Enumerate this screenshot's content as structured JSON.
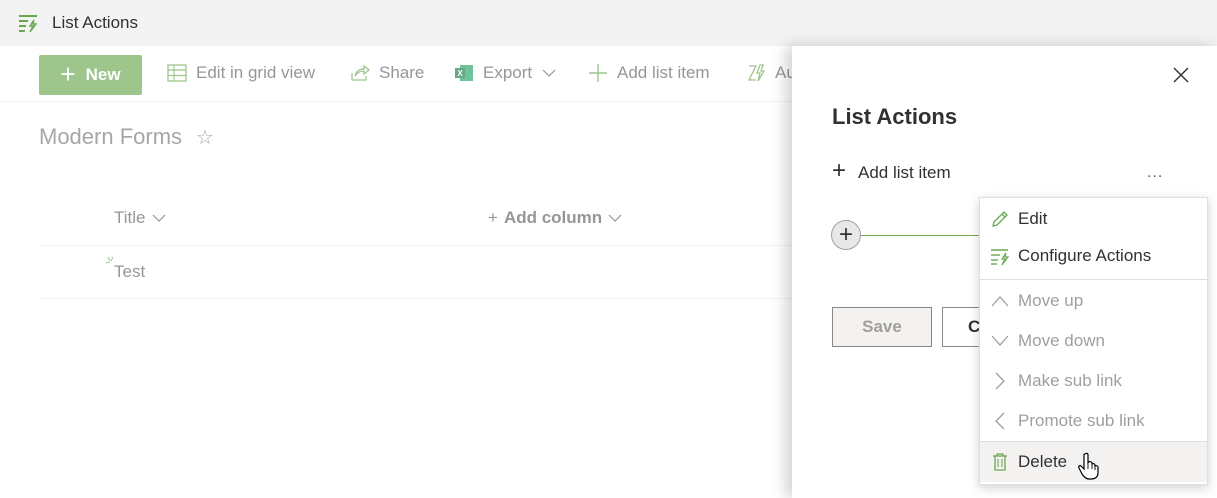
{
  "app": {
    "title": "List Actions"
  },
  "toolbar": {
    "new_label": "New",
    "edit_grid_label": "Edit in grid view",
    "share_label": "Share",
    "export_label": "Export",
    "add_list_item_label": "Add list item",
    "automate_label": "Au"
  },
  "page": {
    "title": "Modern Forms",
    "star": "☆"
  },
  "table": {
    "columns": [
      {
        "label": "Title"
      },
      {
        "label": "Add column"
      }
    ],
    "rows": [
      {
        "title": "Test"
      }
    ]
  },
  "panel": {
    "title": "List Actions",
    "add_list_item_label": "Add list item",
    "more_label": "...",
    "save_label": "Save",
    "cancel_label": "C"
  },
  "menu": {
    "items": [
      {
        "label": "Edit",
        "icon": "pencil-icon",
        "enabled": true
      },
      {
        "label": "Configure Actions",
        "icon": "configure-actions-icon",
        "enabled": true
      },
      {
        "label": "Move up",
        "icon": "chevron-up-icon",
        "enabled": false
      },
      {
        "label": "Move down",
        "icon": "chevron-down-icon",
        "enabled": false
      },
      {
        "label": "Make sub link",
        "icon": "chevron-right-icon",
        "enabled": false
      },
      {
        "label": "Promote sub link",
        "icon": "chevron-left-icon",
        "enabled": false
      },
      {
        "label": "Delete",
        "icon": "trash-icon",
        "enabled": true
      }
    ]
  },
  "colors": {
    "accent": "#6aa84f",
    "disabled_text": "#a19f9d"
  }
}
